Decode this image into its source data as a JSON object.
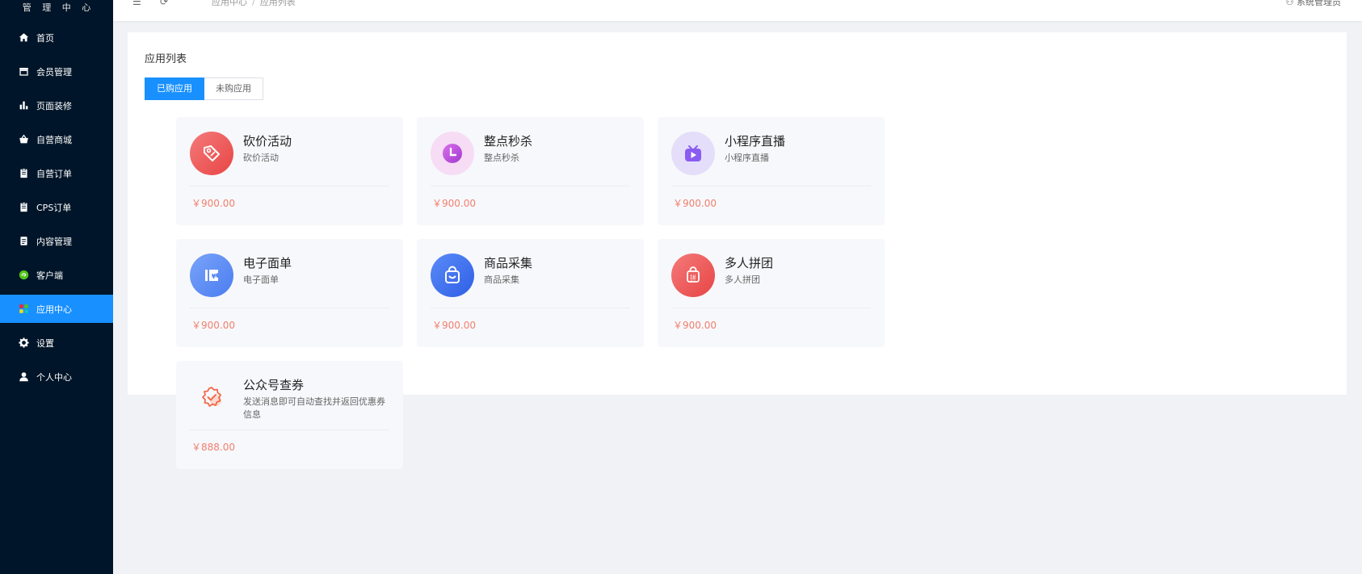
{
  "sidebar": {
    "brand": "管 理 中 心",
    "items": [
      {
        "label": "首页",
        "icon": "home-icon"
      },
      {
        "label": "会员管理",
        "icon": "store-icon"
      },
      {
        "label": "页面装修",
        "icon": "bar-chart-icon"
      },
      {
        "label": "自营商城",
        "icon": "basket-icon"
      },
      {
        "label": "自营订单",
        "icon": "clipboard-icon"
      },
      {
        "label": "CPS订单",
        "icon": "clipboard-icon"
      },
      {
        "label": "内容管理",
        "icon": "document-icon"
      },
      {
        "label": "客户端",
        "icon": "wechat-icon"
      },
      {
        "label": "应用中心",
        "icon": "apps-icon",
        "active": true
      },
      {
        "label": "设置",
        "icon": "gear-icon"
      },
      {
        "label": "个人中心",
        "icon": "user-icon"
      }
    ]
  },
  "header": {
    "breadcrumb": [
      "应用中心",
      "应用列表"
    ],
    "user": "系统管理员"
  },
  "main": {
    "title": "应用列表",
    "tabs": [
      {
        "label": "已购应用",
        "active": true
      },
      {
        "label": "未购应用",
        "active": false
      }
    ],
    "apps": [
      {
        "title": "砍价活动",
        "desc": "砍价活动",
        "price": "￥900.00",
        "icon": "price-tag-icon",
        "color": "#ec5b5b"
      },
      {
        "title": "整点秒杀",
        "desc": "整点秒杀",
        "price": "￥900.00",
        "icon": "clock-icon",
        "color": "#c55fe0"
      },
      {
        "title": "小程序直播",
        "desc": "小程序直播",
        "price": "￥900.00",
        "icon": "tv-play-icon",
        "color": "#8a5cf2"
      },
      {
        "title": "电子面单",
        "desc": "电子面单",
        "price": "￥900.00",
        "icon": "ticket-icon",
        "color": "#5c8df6"
      },
      {
        "title": "商品采集",
        "desc": "商品采集",
        "price": "￥900.00",
        "icon": "shopping-bag-icon",
        "color": "#3d6ff0"
      },
      {
        "title": "多人拼团",
        "desc": "多人拼团",
        "price": "￥900.00",
        "icon": "group-buy-icon",
        "color": "#ec5b5b"
      },
      {
        "title": "公众号查券",
        "desc": "发送消息即可自动查找并返回优惠券信息",
        "price": "￥888.00",
        "icon": "badge-check-icon",
        "color": "#f26b4a"
      }
    ]
  }
}
